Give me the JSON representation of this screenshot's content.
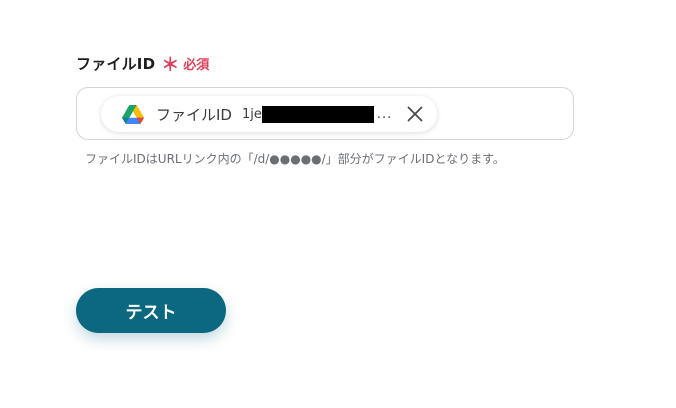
{
  "field": {
    "label": "ファイルID",
    "required_mark": "＊",
    "required_text": "必須",
    "helper": "ファイルIDはURLリンク内の「/d/●●●●●/」部分がファイルIDとなります。"
  },
  "chip": {
    "icon": "google-drive-icon",
    "label": "ファイルID",
    "value_prefix": "1je",
    "ellipsis": "..."
  },
  "actions": {
    "test_label": "テスト"
  },
  "colors": {
    "required": "#e0425c",
    "button_bg": "#0c6780",
    "border": "#d3d6da"
  }
}
